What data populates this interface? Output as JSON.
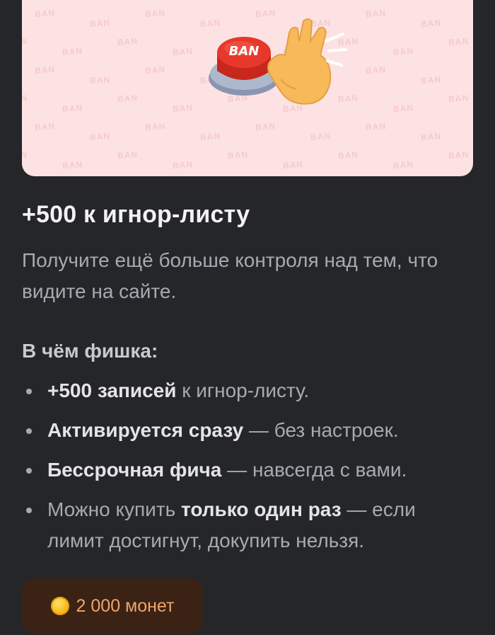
{
  "banner": {
    "pattern_text": "BAN",
    "button_text": "BAN"
  },
  "product": {
    "title": "+500 к игнор-листу",
    "description": "Получите ещё больше контроля над тем, что видите на сайте."
  },
  "features": {
    "heading": "В чём фишка:",
    "items": [
      {
        "bold": "+500 записей",
        "rest": " к игнор-листу."
      },
      {
        "bold": "Активируется сразу",
        "rest": " — без настроек."
      },
      {
        "bold": "Бессрочная фича",
        "rest": " — навсегда с вами."
      },
      {
        "pre": "Можно купить ",
        "bold": "только один раз",
        "rest": " — если лимит достигнут, докупить нельзя."
      }
    ]
  },
  "purchase": {
    "price_label": "2 000 монет",
    "icon": "coin-icon"
  },
  "colors": {
    "background": "#252629",
    "banner": "#fde2e3",
    "button": "#3a2214",
    "price_text": "#f0a46a"
  }
}
